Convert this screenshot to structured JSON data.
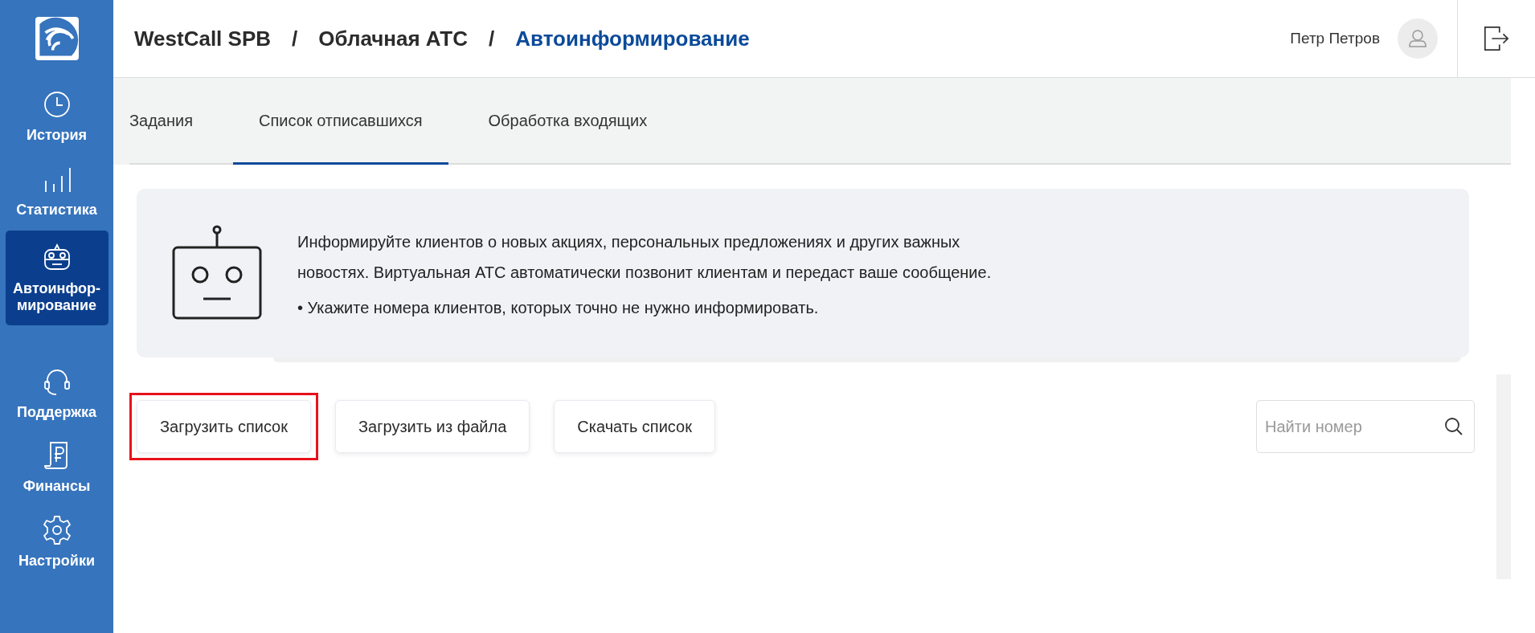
{
  "sidebar": {
    "items": [
      {
        "label": "История",
        "selected": false
      },
      {
        "label": "Статистика",
        "selected": false
      },
      {
        "label": "Автоинфор-мирование",
        "selected": true
      },
      {
        "label": "Поддержка",
        "selected": false
      },
      {
        "label": "Финансы",
        "selected": false
      },
      {
        "label": "Настройки",
        "selected": false
      }
    ]
  },
  "header": {
    "breadcrumbs": [
      {
        "label": "WestCall SPB",
        "current": false
      },
      {
        "label": "Облачная АТС",
        "current": false
      },
      {
        "label": "Автоинформирование",
        "current": true
      }
    ],
    "separator": "/",
    "user_name": "Петр Петров"
  },
  "tabs": [
    {
      "label": "Задания",
      "selected": false
    },
    {
      "label": "Список отписавшихся",
      "selected": true
    },
    {
      "label": "Обработка входящих",
      "selected": false
    }
  ],
  "info": {
    "paragraph": "Информируйте клиентов о новых акциях, персональных предложениях и других важных новостях. Виртуальная АТС автоматически позвонит клиентам и передаст ваше сообщение.",
    "bullet": "• Укажите номера клиентов, которых точно не нужно информировать."
  },
  "buttons": [
    {
      "label": "Загрузить список",
      "highlighted": true
    },
    {
      "label": "Загрузить из файла",
      "highlighted": false
    },
    {
      "label": "Скачать список",
      "highlighted": false
    }
  ],
  "search": {
    "placeholder": "Найти номер"
  }
}
